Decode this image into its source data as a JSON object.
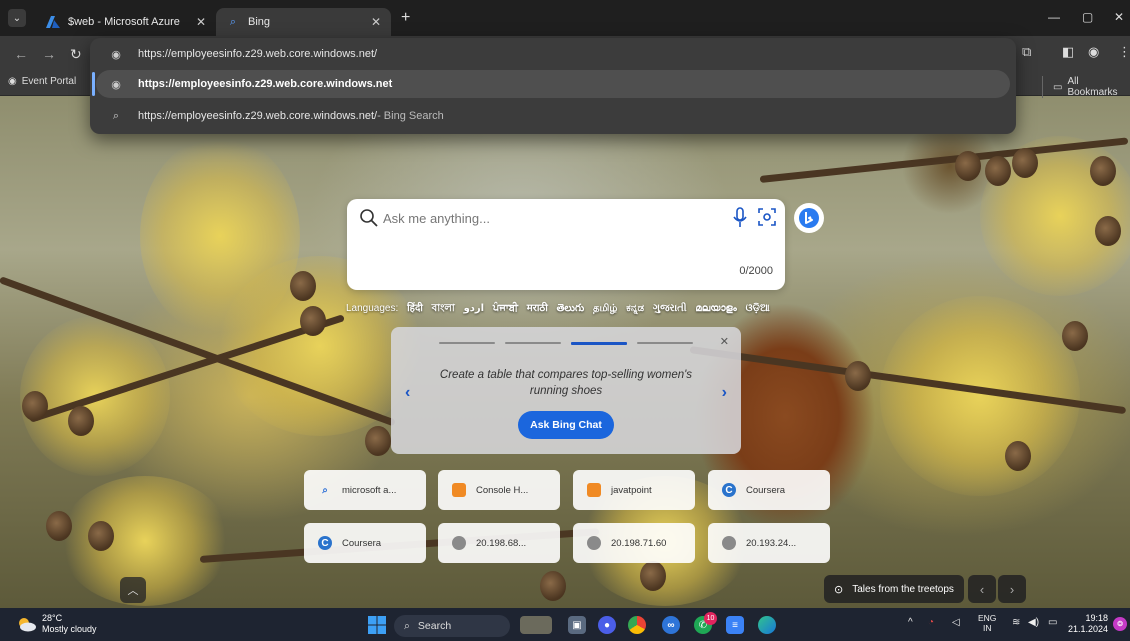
{
  "browser": {
    "tabs": [
      {
        "title": "$web - Microsoft Azure",
        "icon": "azure-icon"
      },
      {
        "title": "Bing",
        "icon": "bing-icon"
      }
    ],
    "address_value": "https://employeesinfo.z29.web.core.windows.net/",
    "suggestions": [
      {
        "text": "https://employeesinfo.z29.web.core.windows.net",
        "suffix": "",
        "icon": "globe-icon"
      },
      {
        "text": "https://employeesinfo.z29.web.core.windows.net/",
        "suffix": " - Bing Search",
        "icon": "search-icon"
      }
    ],
    "bookmarks": {
      "event_portal": "Event Portal",
      "all_bookmarks": "All Bookmarks"
    }
  },
  "bing": {
    "search_placeholder": "Ask me anything...",
    "char_count": "0/2000",
    "languages_label": "Languages:",
    "languages": [
      "हिंदी",
      "বাংলা",
      "اردو",
      "ਪੰਜਾਬੀ",
      "मराठी",
      "తెలుగు",
      "தமிழ்",
      "ಕನ್ನಡ",
      "ગુજરાતી",
      "മലയാളം",
      "ଓଡ଼ିଆ"
    ],
    "card": {
      "prompt": "Create a table that compares top-selling women's running shoes",
      "button": "Ask Bing Chat"
    },
    "quick_links": [
      {
        "label": "microsoft a...",
        "icon": "search-icon",
        "color": "#2b6fd6"
      },
      {
        "label": "Console H...",
        "icon": "cube-icon",
        "color": "#f08a24"
      },
      {
        "label": "javatpoint",
        "icon": "cube-icon",
        "color": "#f08a24"
      },
      {
        "label": "Coursera",
        "icon": "coursera-icon",
        "color": "#2a73cc"
      },
      {
        "label": "Coursera",
        "icon": "coursera-icon",
        "color": "#2a73cc"
      },
      {
        "label": "20.198.68...",
        "icon": "globe-icon",
        "color": "#777777"
      },
      {
        "label": "20.198.71.60",
        "icon": "globe-icon",
        "color": "#777777"
      },
      {
        "label": "20.193.24...",
        "icon": "globe-icon",
        "color": "#777777"
      }
    ],
    "image_title": "Tales from the treetops"
  },
  "taskbar": {
    "temperature": "28°C",
    "weather": "Mostly cloudy",
    "search_label": "Search",
    "language": "ENG",
    "region": "IN",
    "time": "19:18",
    "date": "21.1.2024",
    "badge_count": "10"
  }
}
